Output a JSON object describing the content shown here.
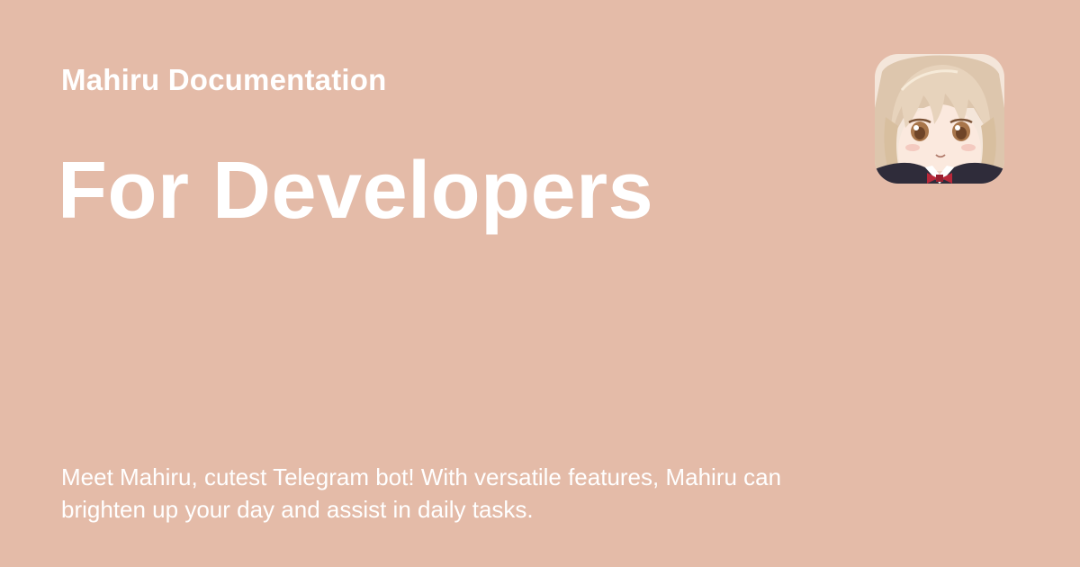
{
  "colors": {
    "background": "#e4bba8",
    "text": "#ffffff"
  },
  "header": {
    "site_name": "Mahiru Documentation"
  },
  "main": {
    "title": "For Developers",
    "description": "Meet Mahiru, cutest Telegram bot! With versatile features, Mahiru can brighten up your day and assist in daily tasks."
  },
  "avatar": {
    "icon": "anime-girl-avatar-icon"
  }
}
